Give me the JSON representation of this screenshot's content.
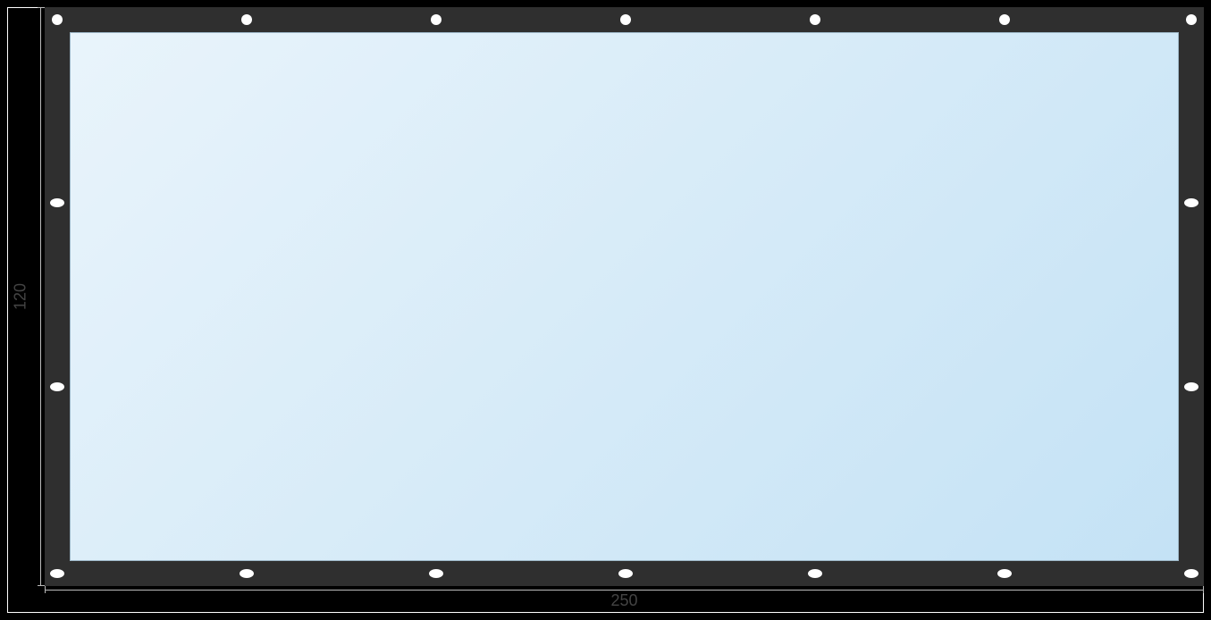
{
  "dimensions": {
    "width_label": "250",
    "height_label": "120"
  },
  "tarp": {
    "border_color": "#2f2f2f",
    "body_gradient_from": "#e9f4fb",
    "body_gradient_to": "#c4e2f5"
  },
  "grommets": {
    "top_count": 7,
    "bottom_count": 7,
    "left_count": 2,
    "right_count": 2
  }
}
